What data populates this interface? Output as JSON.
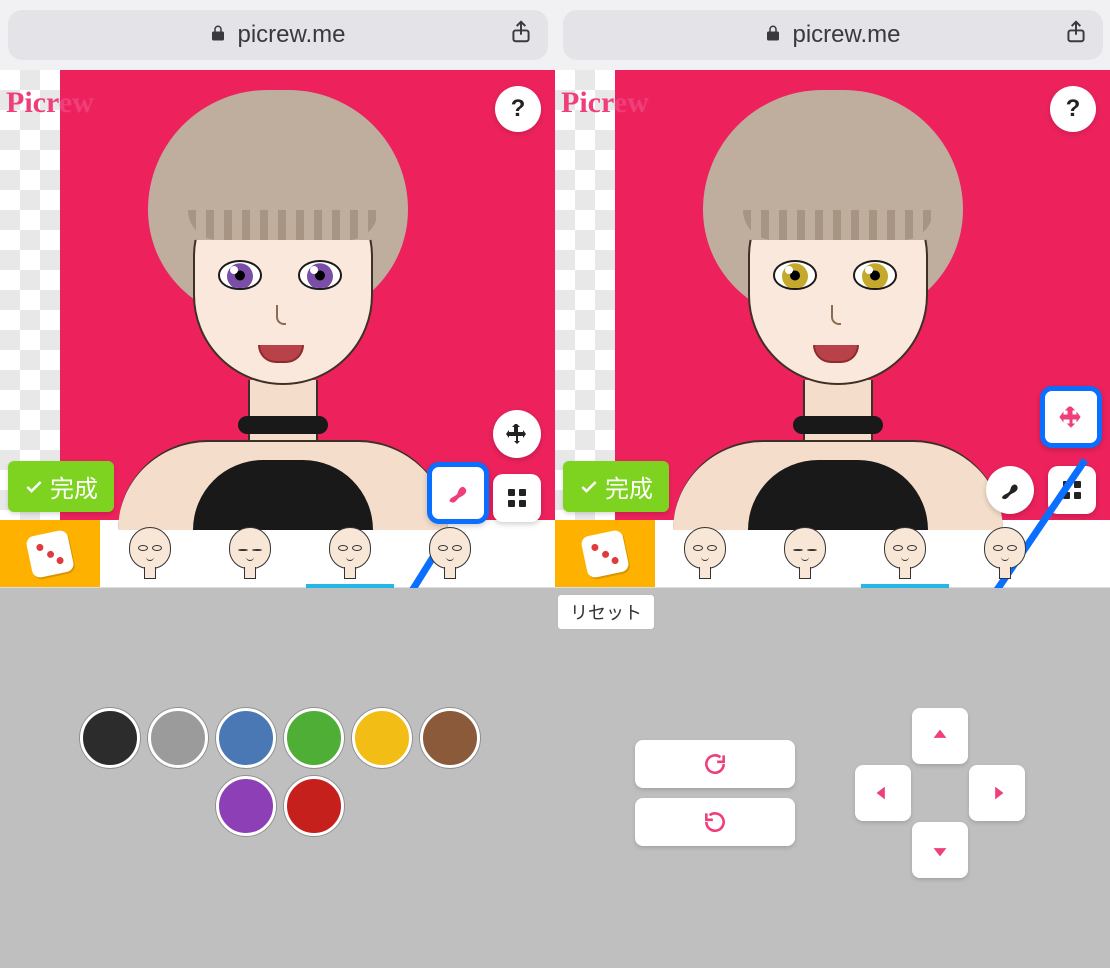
{
  "browser": {
    "url": "picrew.me"
  },
  "app": {
    "logo_text": "Picrew",
    "help_label": "?",
    "done_label": "完成",
    "reset_label": "リセット"
  },
  "panes": {
    "left": {
      "eye_color": "#7a4ea6",
      "highlighted_tool": "color",
      "editor_mode": "color",
      "swatches": [
        "#2c2c2c",
        "#9b9b9b",
        "#4a78b5",
        "#4fae36",
        "#f2bd14",
        "#8a5a3b",
        "#8d3fb5",
        "#c6201d"
      ],
      "categories": [
        {
          "id": "dice",
          "type": "dice"
        },
        {
          "id": "face1",
          "type": "head",
          "eyes": "open"
        },
        {
          "id": "face2",
          "type": "head",
          "eyes": "closed"
        },
        {
          "id": "face3",
          "type": "head",
          "eyes": "open",
          "active": true
        },
        {
          "id": "face4",
          "type": "head",
          "eyes": "open"
        }
      ]
    },
    "right": {
      "eye_color": "#c5a92c",
      "highlighted_tool": "move",
      "editor_mode": "move",
      "categories": [
        {
          "id": "dice",
          "type": "dice"
        },
        {
          "id": "face1",
          "type": "head",
          "eyes": "open"
        },
        {
          "id": "face2",
          "type": "head",
          "eyes": "closed"
        },
        {
          "id": "face3",
          "type": "head",
          "eyes": "open",
          "active": true
        },
        {
          "id": "face4",
          "type": "head",
          "eyes": "open"
        }
      ]
    }
  },
  "icons": {
    "move": "move-icon",
    "grid": "grid-icon",
    "brush": "brush-icon"
  },
  "colors": {
    "accent_pink": "#ef3f7a",
    "accent_blue": "#0a6fff",
    "bg_magenta": "#ed225d",
    "done_green": "#7ed321"
  }
}
